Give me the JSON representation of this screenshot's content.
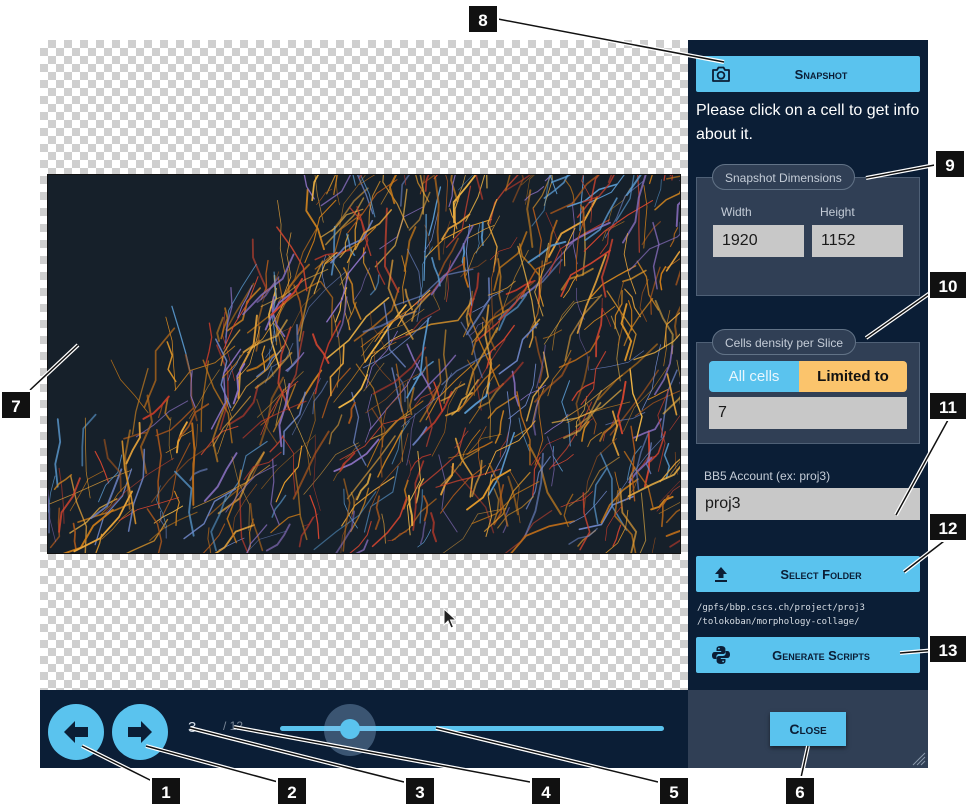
{
  "viewer": {
    "current_frame": "3",
    "total_frames": "/ 12",
    "slider_value": 0.18,
    "prev_icon": "arrow-left-icon",
    "next_icon": "arrow-right-icon"
  },
  "sidebar": {
    "snapshot_label": "Snapshot",
    "snapshot_icon": "camera-icon",
    "info_text": "Please click on a cell to get info about it.",
    "dimensions": {
      "legend": "Snapshot Dimensions",
      "width_label": "Width",
      "width_value": "1920",
      "height_label": "Height",
      "height_value": "1152"
    },
    "density": {
      "legend": "Cells density per Slice",
      "option_all": "All cells",
      "option_limited": "Limited to",
      "selected": "Limited to",
      "limit_value": "7"
    },
    "account": {
      "label": "BB5 Account (ex: proj3)",
      "value": "proj3"
    },
    "select_folder_label": "Select Folder",
    "upload_icon": "upload-icon",
    "folder_path_line1": "/gpfs/bbp.cscs.ch/project/proj3",
    "folder_path_line2": "/tolokoban/morphology-collage/",
    "generate_label": "Generate Scripts",
    "python_icon": "python-icon",
    "close_label": "Close"
  },
  "callouts": [
    "1",
    "2",
    "3",
    "4",
    "5",
    "6",
    "7",
    "8",
    "9",
    "10",
    "11",
    "12",
    "13"
  ],
  "colors": {
    "accent": "#5ac3ee",
    "panel_dark": "#0b1e36",
    "panel_mid": "#303f55",
    "selected_option": "#fbc46c"
  }
}
